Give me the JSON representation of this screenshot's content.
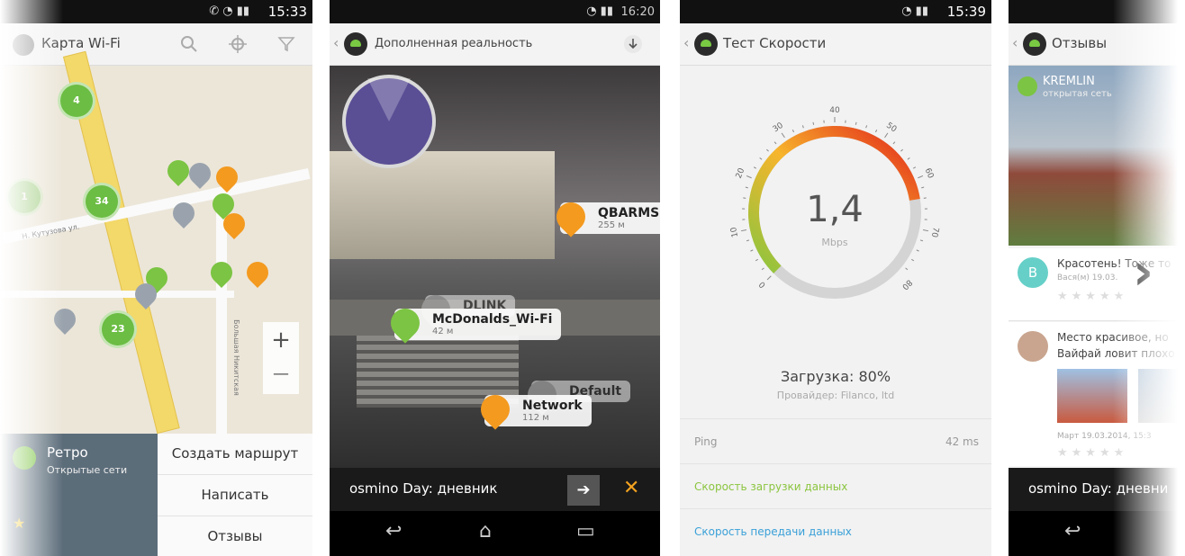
{
  "phone1": {
    "time": "15:33",
    "title": "Карта Wi-Fi",
    "clusters": [
      "4",
      "34",
      "23",
      "1"
    ],
    "street1": "Н. Кутузова ул.",
    "street2": "Большая Никитская",
    "zoom_in": "+",
    "zoom_out": "—",
    "place_name": "Ретро",
    "place_sub": "Открытые сети",
    "menu": [
      "Создать маршрут",
      "Написать",
      "Отзывы"
    ]
  },
  "phone2": {
    "time": "16:20",
    "title": "Дополненная реальность",
    "pois": [
      {
        "name": "QBARMSK",
        "dist": "255 м"
      },
      {
        "name": "DLINK",
        "dist": ""
      },
      {
        "name": "McDonalds_Wi-Fi",
        "dist": "42 м"
      },
      {
        "name": "Default",
        "dist": ""
      },
      {
        "name": "Network",
        "dist": "112 м"
      }
    ],
    "bar_text": "osmino Day: дневник",
    "close": "✕"
  },
  "phone3": {
    "time": "15:39",
    "title": "Тест Скорости",
    "gauge_value": "1,4",
    "gauge_unit": "Mbps",
    "gauge_ticks": [
      "0",
      "10",
      "20",
      "30",
      "40",
      "50",
      "60",
      "70",
      "80"
    ],
    "progress_percent": 80,
    "load_text": "Загрузка: 80%",
    "provider_text": "Провайдер: Filanco, ltd",
    "ping_label": "Ping",
    "ping_value": "42 ms",
    "download_label": "Скорость загрузки данных",
    "upload_label": "Скорость передачи данных"
  },
  "phone4": {
    "title": "Отзывы",
    "header_name": "KREMLIN",
    "header_sub": "открытая сеть",
    "review1_avatar": "B",
    "review1_text": "Красотень! Тоже то",
    "review1_author": "Вася(м) 19.03.",
    "review2_text": "Место красивое, но",
    "review2_text2": "Вайфай ловит плохо",
    "review2_date": "Март 19.03.2014, 15:3",
    "bar_text": "osmino Day: дневни",
    "next": "›"
  },
  "colors": {
    "green": "#7cc443",
    "orange": "#f39a1f",
    "gauge_start": "#8bc53f",
    "gauge_mid": "#f7b52c",
    "gauge_end": "#e2231a",
    "link_green": "#8bc53f",
    "link_blue": "#3aa0d8"
  }
}
